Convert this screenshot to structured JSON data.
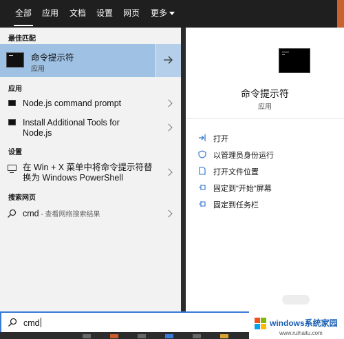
{
  "tabs": [
    {
      "label": "全部",
      "active": true
    },
    {
      "label": "应用"
    },
    {
      "label": "文档"
    },
    {
      "label": "设置"
    },
    {
      "label": "网页"
    },
    {
      "label": "更多"
    }
  ],
  "sections": {
    "best_match": "最佳匹配",
    "apps": "应用",
    "settings": "设置",
    "web": "搜索网页"
  },
  "best_match": {
    "title": "命令提示符",
    "subtitle": "应用",
    "icon": "terminal-icon"
  },
  "apps": [
    {
      "label": "Node.js command prompt",
      "icon": "terminal-icon"
    },
    {
      "label_line1": "Install Additional Tools for",
      "label_line2": "Node.js",
      "icon": "terminal-icon"
    }
  ],
  "settings_item": {
    "label_line1": "在 Win + X 菜单中将命令提示符替",
    "label_line2": "换为 Windows PowerShell",
    "icon": "monitor-icon"
  },
  "web_item": {
    "query": "cmd",
    "desc": " - 查看网络搜索结果",
    "icon": "search-icon"
  },
  "preview": {
    "title": "命令提示符",
    "subtitle": "应用",
    "actions": [
      {
        "label": "打开",
        "icon": "open-icon"
      },
      {
        "label": "以管理员身份运行",
        "icon": "shield-run-icon"
      },
      {
        "label": "打开文件位置",
        "icon": "file-location-icon"
      },
      {
        "label": "固定到\"开始\"屏幕",
        "icon": "pin-icon"
      },
      {
        "label": "固定到任务栏",
        "icon": "pin-icon"
      }
    ]
  },
  "search": {
    "value": "cmd"
  },
  "watermark": {
    "brand": "windows系统家园",
    "url": "www.ruihaitu.com"
  },
  "colors": {
    "accent": "#3a7bd5",
    "selected_row": "#9ec1e4",
    "topbar": "#1f1f1f"
  }
}
